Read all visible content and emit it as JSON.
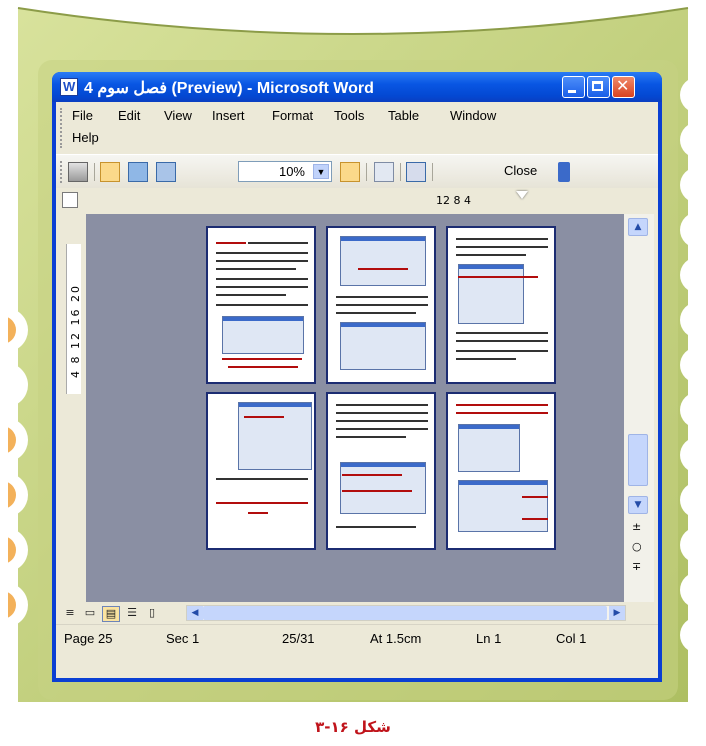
{
  "window": {
    "title": "فصل سوم 4 (Preview) - Microsoft Word"
  },
  "menu": {
    "items": [
      "File",
      "Edit",
      "View",
      "Insert",
      "Format",
      "Tools",
      "Table",
      "Window",
      "Help"
    ]
  },
  "toolbar": {
    "zoom_value": "10%",
    "close_label": "Close",
    "icons": [
      "print-icon",
      "magnifier-icon",
      "one-page-icon",
      "multiple-pages-icon",
      "view-ruler-icon",
      "shrink-to-fit-icon",
      "full-screen-icon"
    ]
  },
  "ruler": {
    "horizontal_text": "12  8  4",
    "vertical_text": "4  8  12  16  20"
  },
  "document": {
    "page_count_shown": 6
  },
  "status": {
    "page": "Page 25",
    "section": "Sec 1",
    "page_of": "25/31",
    "at": "At 1.5cm",
    "line": "Ln 1",
    "col": "Col 1"
  },
  "caption": "شکل ۱۶-۳",
  "colors": {
    "titlebar": "#0a54e6",
    "frame_green": "#b9c978",
    "doc_background": "#8a8fa3",
    "caption": "#c0141b"
  }
}
